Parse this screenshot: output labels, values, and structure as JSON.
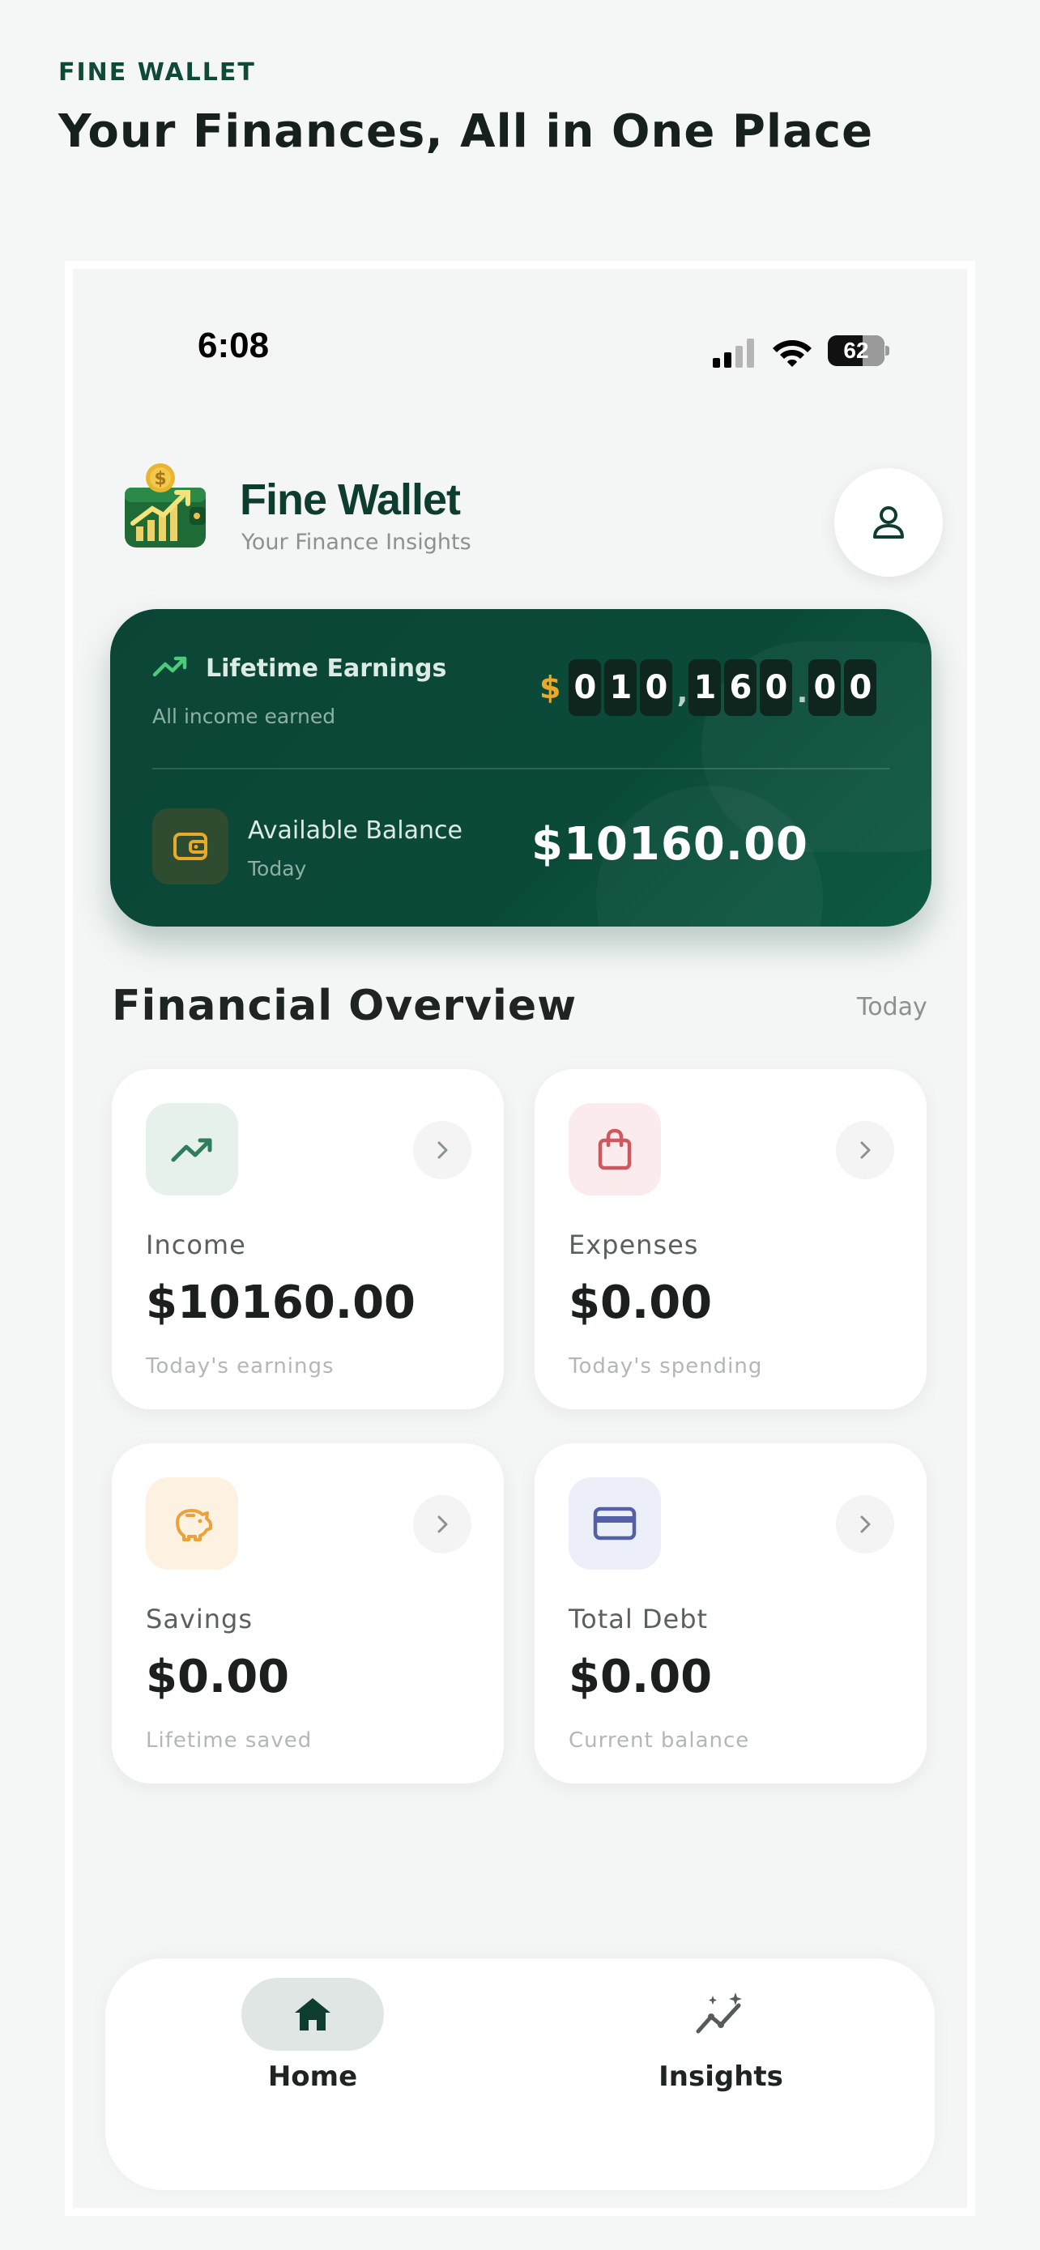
{
  "page": {
    "brand_tag": "FINE WALLET",
    "title": "Your Finances, All in One Place"
  },
  "status_bar": {
    "time": "6:08",
    "battery_percent": "62",
    "icons": [
      "cellular-signal-icon",
      "wifi-icon",
      "battery-icon"
    ]
  },
  "app": {
    "name": "Fine Wallet",
    "subtitle": "Your Finance Insights",
    "logo_icon": "wallet-growth-logo",
    "profile_icon": "user-icon"
  },
  "earnings_card": {
    "title": "Lifetime Earnings",
    "subtitle": "All income earned",
    "currency_symbol": "$",
    "odometer": [
      "0",
      "1",
      "0",
      ",",
      "1",
      "6",
      "0",
      ".",
      "0",
      "0"
    ],
    "balance_title": "Available Balance",
    "balance_subtitle": "Today",
    "balance_value": "$10160.00",
    "icons": [
      "trending-up-icon",
      "wallet-icon"
    ]
  },
  "overview": {
    "title": "Financial Overview",
    "period": "Today",
    "cards": [
      {
        "label": "Income",
        "value": "$10160.00",
        "note": "Today's earnings",
        "icon": "trending-up-icon",
        "accent": "#2E7D5B",
        "tint": "#E6F1EC"
      },
      {
        "label": "Expenses",
        "value": "$0.00",
        "note": "Today's spending",
        "icon": "shopping-bag-icon",
        "accent": "#D0585C",
        "tint": "#FBEBEC"
      },
      {
        "label": "Savings",
        "value": "$0.00",
        "note": "Lifetime saved",
        "icon": "piggy-bank-icon",
        "accent": "#EBA23A",
        "tint": "#FDF1E2"
      },
      {
        "label": "Total Debt",
        "value": "$0.00",
        "note": "Current balance",
        "icon": "credit-card-icon",
        "accent": "#5360A8",
        "tint": "#ECEEF8"
      }
    ]
  },
  "nav": {
    "items": [
      {
        "label": "Home",
        "icon": "home-icon",
        "active": true
      },
      {
        "label": "Insights",
        "icon": "insights-icon",
        "active": false
      }
    ]
  },
  "colors": {
    "brand": "#0B4535",
    "accent_gold": "#E9A92A",
    "background": "#F5F7F6"
  }
}
